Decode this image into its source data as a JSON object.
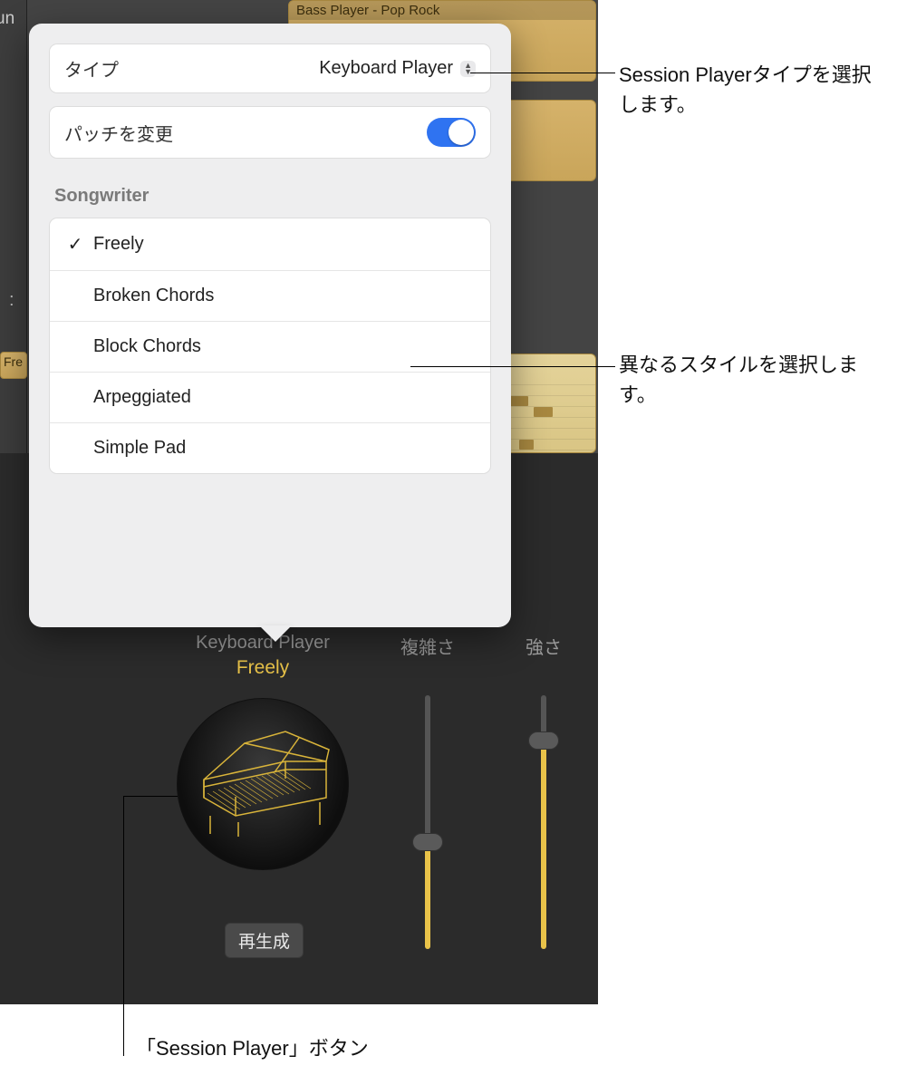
{
  "tracks": {
    "region1_title": "Bass Player - Pop Rock"
  },
  "popover": {
    "type_label": "タイプ",
    "type_value": "Keyboard Player",
    "patch_label": "パッチを変更",
    "section_title": "Songwriter",
    "styles": [
      {
        "name": "Freely",
        "selected": true
      },
      {
        "name": "Broken Chords",
        "selected": false
      },
      {
        "name": "Block Chords",
        "selected": false
      },
      {
        "name": "Arpeggiated",
        "selected": false
      },
      {
        "name": "Simple Pad",
        "selected": false
      }
    ]
  },
  "editor": {
    "player_label": "Keyboard Player",
    "player_style": "Freely",
    "regenerate": "再生成",
    "slider1_label": "複雑さ",
    "slider1_value": 42,
    "slider2_label": "強さ",
    "slider2_value": 82
  },
  "callouts": {
    "c1": "Session Playerタイプを選択します。",
    "c2": "異なるスタイルを選択します。",
    "c3": "「Session Player」ボタン"
  },
  "sidebar_text": "Fre"
}
